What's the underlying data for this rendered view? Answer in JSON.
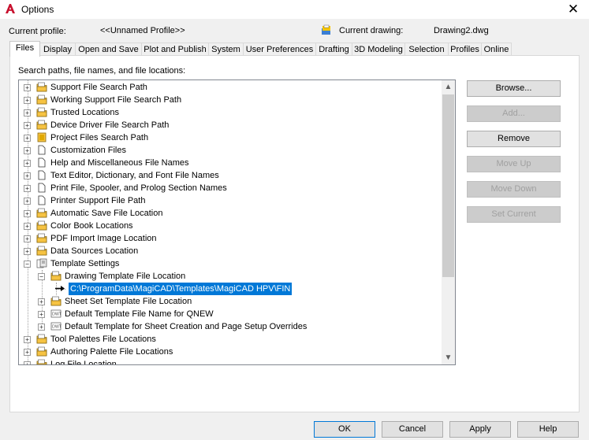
{
  "window": {
    "title": "Options",
    "close_glyph": "✕"
  },
  "profile": {
    "current_profile_label": "Current profile:",
    "current_profile_value": "<<Unnamed Profile>>",
    "current_drawing_label": "Current drawing:",
    "current_drawing_value": "Drawing2.dwg"
  },
  "tabs": [
    "Files",
    "Display",
    "Open and Save",
    "Plot and Publish",
    "System",
    "User Preferences",
    "Drafting",
    "3D Modeling",
    "Selection",
    "Profiles",
    "Online"
  ],
  "active_tab": "Files",
  "panel": {
    "search_label": "Search paths, file names, and file locations:"
  },
  "tree": [
    {
      "label": "Support File Search Path",
      "icon": "folder-icon",
      "expander": "+"
    },
    {
      "label": "Working Support File Search Path",
      "icon": "folder-icon",
      "expander": "+"
    },
    {
      "label": "Trusted Locations",
      "icon": "folder-icon",
      "expander": "+"
    },
    {
      "label": "Device Driver File Search Path",
      "icon": "folder-icon",
      "expander": "+"
    },
    {
      "label": "Project Files Search Path",
      "icon": "project-folder-icon",
      "expander": "+"
    },
    {
      "label": "Customization Files",
      "icon": "file-icon",
      "expander": "+"
    },
    {
      "label": "Help and Miscellaneous File Names",
      "icon": "file-icon",
      "expander": "+"
    },
    {
      "label": "Text Editor, Dictionary, and Font File Names",
      "icon": "file-icon",
      "expander": "+"
    },
    {
      "label": "Print File, Spooler, and Prolog Section Names",
      "icon": "file-icon",
      "expander": "+"
    },
    {
      "label": "Printer Support File Path",
      "icon": "file-icon",
      "expander": "+"
    },
    {
      "label": "Automatic Save File Location",
      "icon": "folder-icon",
      "expander": "+"
    },
    {
      "label": "Color Book Locations",
      "icon": "folder-icon",
      "expander": "+"
    },
    {
      "label": "PDF Import Image Location",
      "icon": "folder-icon",
      "expander": "+"
    },
    {
      "label": "Data Sources Location",
      "icon": "folder-icon",
      "expander": "+"
    },
    {
      "label": "Template Settings",
      "icon": "settings-icon",
      "expander": "−"
    },
    {
      "label": "Drawing Template File Location",
      "icon": "folder-icon",
      "expander": "−"
    },
    {
      "label": "C:\\ProgramData\\MagiCAD\\Templates\\MagiCAD HPV\\FIN",
      "icon": "arrow-icon",
      "selected": true
    },
    {
      "label": "Sheet Set Template File Location",
      "icon": "folder-icon",
      "expander": "+"
    },
    {
      "label": "Default Template File Name for QNEW",
      "icon": "template-file-icon",
      "expander": "+"
    },
    {
      "label": "Default Template for Sheet Creation and Page Setup Overrides",
      "icon": "template-file-icon",
      "expander": "+"
    },
    {
      "label": "Tool Palettes File Locations",
      "icon": "folder-icon",
      "expander": "+"
    },
    {
      "label": "Authoring Palette File Locations",
      "icon": "folder-icon",
      "expander": "+"
    },
    {
      "label": "Log File Location",
      "icon": "folder-icon",
      "expander": "+"
    }
  ],
  "side_buttons": [
    {
      "label": "Browse...",
      "enabled": true
    },
    {
      "label": "Add...",
      "enabled": false
    },
    {
      "label": "Remove",
      "enabled": true
    },
    {
      "label": "Move Up",
      "enabled": false
    },
    {
      "label": "Move Down",
      "enabled": false
    },
    {
      "label": "Set Current",
      "enabled": false
    }
  ],
  "footer_buttons": [
    "OK",
    "Cancel",
    "Apply",
    "Help"
  ],
  "scroll": {
    "up_glyph": "▲",
    "down_glyph": "▼"
  }
}
